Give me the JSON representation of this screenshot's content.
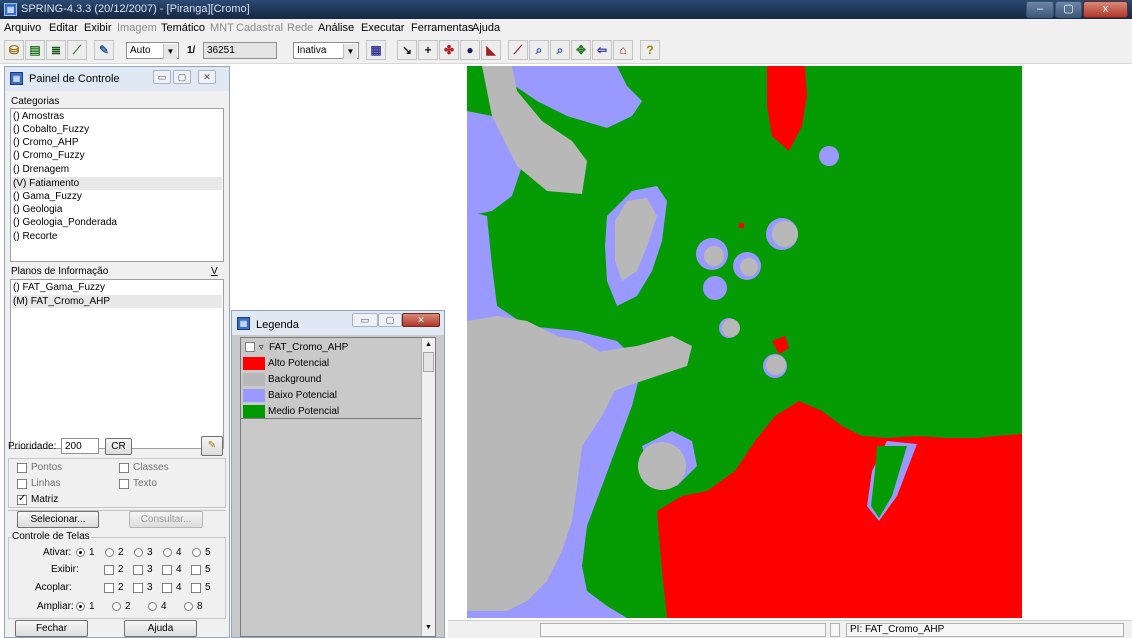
{
  "window": {
    "title": "SPRING-4.3.3 (20/12/2007) - [Piranga][Cromo]",
    "app_icon": "spring-app-icon",
    "buttons": {
      "minimize": "–",
      "restore": "▢",
      "close": "x"
    }
  },
  "menu": [
    {
      "label": "Arquivo",
      "enabled": true
    },
    {
      "label": "Editar",
      "enabled": true
    },
    {
      "label": "Exibir",
      "enabled": true
    },
    {
      "label": "Imagem",
      "enabled": false
    },
    {
      "label": "Temático",
      "enabled": true
    },
    {
      "label": "MNT",
      "enabled": false
    },
    {
      "label": "Cadastral",
      "enabled": false
    },
    {
      "label": "Rede",
      "enabled": false
    },
    {
      "label": "Análise",
      "enabled": true
    },
    {
      "label": "Executar",
      "enabled": true
    },
    {
      "label": "Ferramentas",
      "enabled": true
    },
    {
      "label": "Ajuda",
      "enabled": true
    }
  ],
  "toolbar": {
    "scale_mode": "Auto",
    "scale_prefix": "1/",
    "scale_value": "36251",
    "tool_state": "Inativa"
  },
  "control_panel": {
    "title": "Painel de Controle",
    "categories_label": "Categorias",
    "categories": [
      "() Amostras",
      "() Cobalto_Fuzzy",
      "() Cromo_AHP",
      "() Cromo_Fuzzy",
      "() Drenagem",
      "(V) Fatiamento",
      "() Gama_Fuzzy",
      "() Geologia",
      "() Geologia_Ponderada",
      "() Recorte"
    ],
    "selected_category_index": 5,
    "info_planes_label": "Planos de Informação",
    "info_planes_toggle": "V",
    "info_planes": [
      "() FAT_Gama_Fuzzy",
      "(M) FAT_Cromo_AHP"
    ],
    "selected_plane_index": 1,
    "priority_label": "Prioridade:",
    "priority_value": "200",
    "cr_label": "CR",
    "representations": {
      "pontos": {
        "label": "Pontos",
        "checked": false
      },
      "classes": {
        "label": "Classes",
        "checked": false
      },
      "linhas": {
        "label": "Linhas",
        "checked": false
      },
      "texto": {
        "label": "Texto",
        "checked": false
      },
      "matriz": {
        "label": "Matriz",
        "checked": true
      }
    },
    "select_button": "Selecionar...",
    "query_button": "Consultar...",
    "screens_group": "Controle de Telas",
    "ativar_label": "Ativar:",
    "exibir_label": "Exibir:",
    "acoplar_label": "Acoplar:",
    "ampliar_label": "Ampliar:",
    "ativar_options": [
      "1",
      "2",
      "3",
      "4",
      "5"
    ],
    "exibir_options": [
      "2",
      "3",
      "4",
      "5"
    ],
    "acoplar_options": [
      "2",
      "3",
      "4",
      "5"
    ],
    "ampliar_options": [
      "1",
      "2",
      "4",
      "8"
    ],
    "close_button": "Fechar",
    "help_button": "Ajuda"
  },
  "legend": {
    "title": "Legenda",
    "layer": "FAT_Cromo_AHP",
    "items": [
      {
        "label": "Alto Potencial",
        "color": "#ff0000"
      },
      {
        "label": "Background",
        "color": "#b8b8b8"
      },
      {
        "label": "Baixo Potencial",
        "color": "#9999ff"
      },
      {
        "label": "Medio Potencial",
        "color": "#009900"
      }
    ]
  },
  "status": {
    "pi": "PI: FAT_Cromo_AHP"
  },
  "colors": {
    "alto": "#ff0000",
    "background": "#b8b8b8",
    "baixo": "#9999ff",
    "medio": "#049b05"
  }
}
